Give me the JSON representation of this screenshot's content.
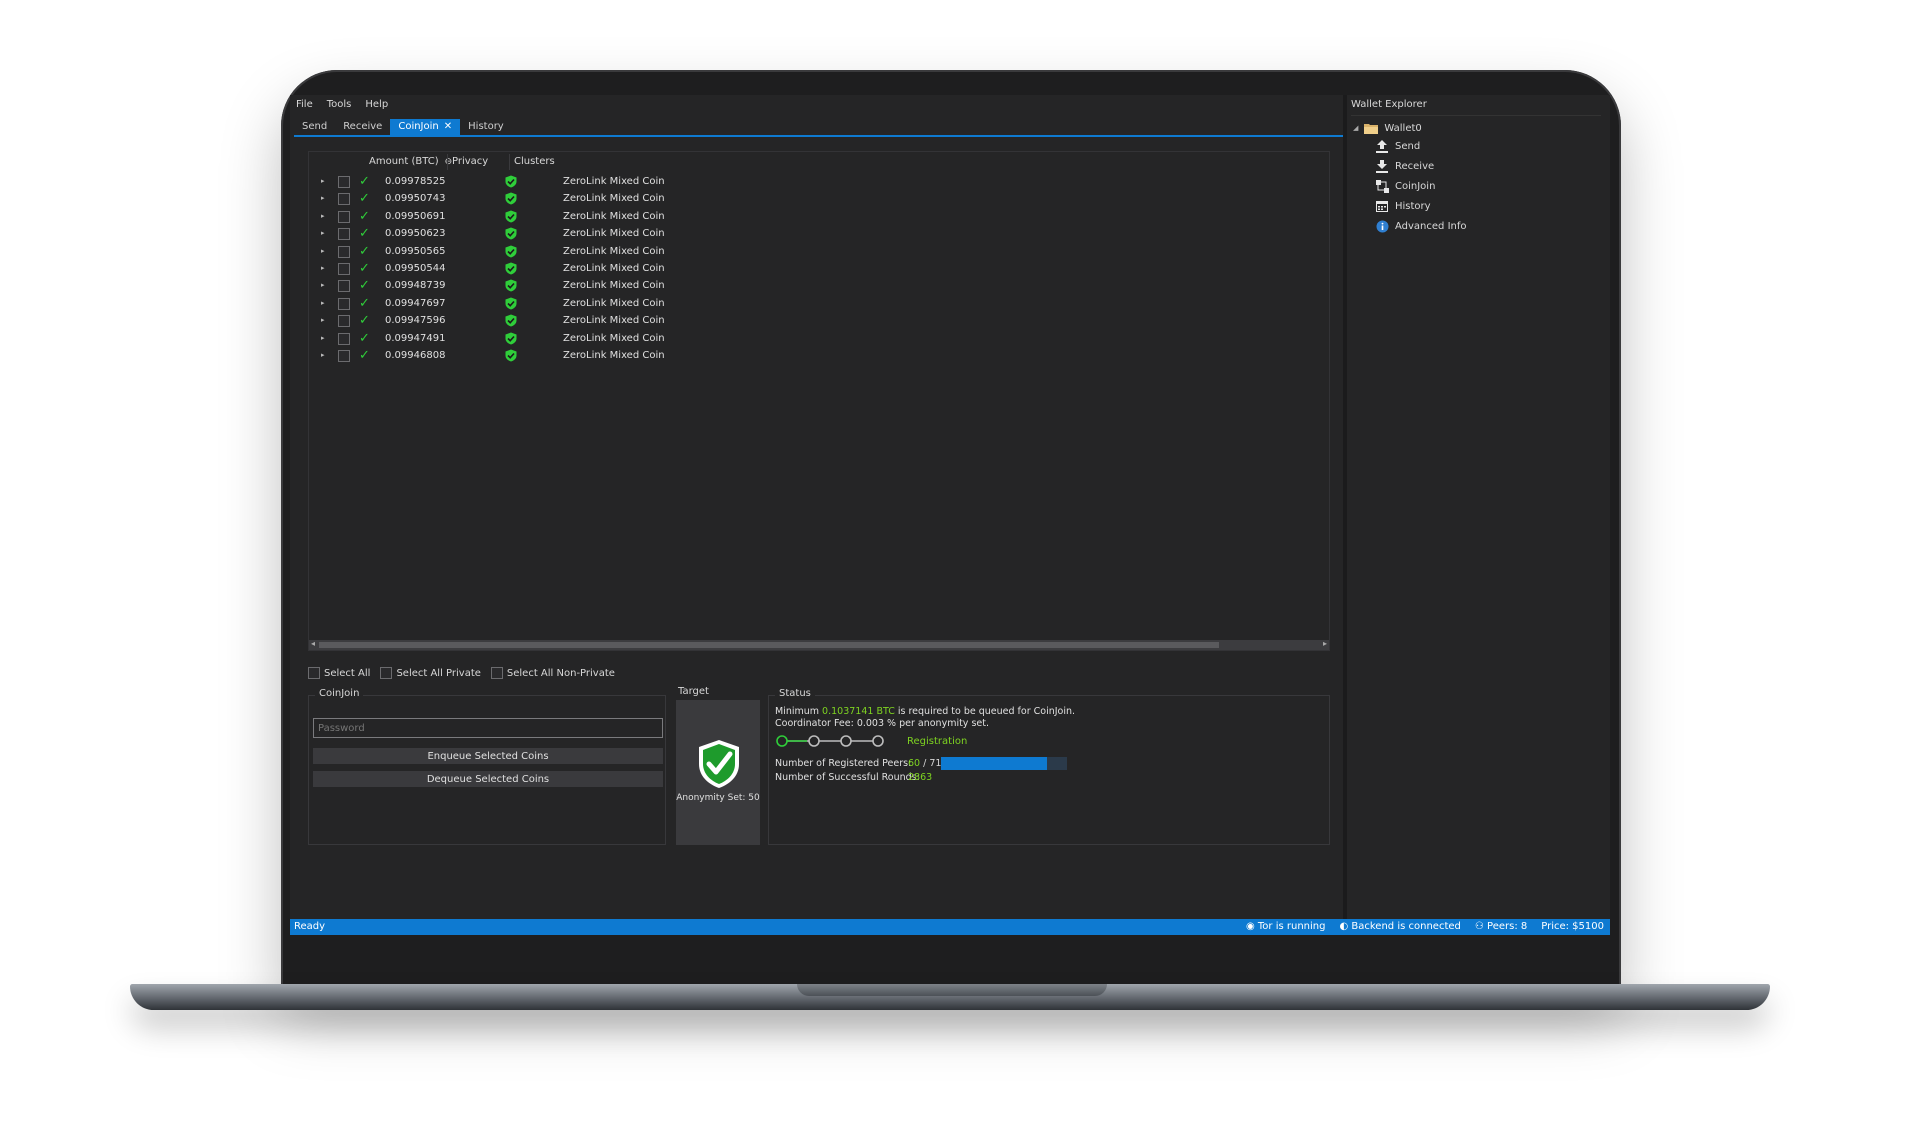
{
  "menu": [
    "File",
    "Tools",
    "Help"
  ],
  "tabs": [
    {
      "label": "Send",
      "active": false
    },
    {
      "label": "Receive",
      "active": false
    },
    {
      "label": "CoinJoin",
      "active": true
    },
    {
      "label": "History",
      "active": false
    }
  ],
  "coinlist": {
    "headers": {
      "amount": "Amount (BTC)",
      "privacy": "Privacy",
      "clusters": "Clusters"
    },
    "rows": [
      {
        "amount": "0.09978525",
        "cluster": "ZeroLink Mixed Coin"
      },
      {
        "amount": "0.09950743",
        "cluster": "ZeroLink Mixed Coin"
      },
      {
        "amount": "0.09950691",
        "cluster": "ZeroLink Mixed Coin"
      },
      {
        "amount": "0.09950623",
        "cluster": "ZeroLink Mixed Coin"
      },
      {
        "amount": "0.09950565",
        "cluster": "ZeroLink Mixed Coin"
      },
      {
        "amount": "0.09950544",
        "cluster": "ZeroLink Mixed Coin"
      },
      {
        "amount": "0.09948739",
        "cluster": "ZeroLink Mixed Coin"
      },
      {
        "amount": "0.09947697",
        "cluster": "ZeroLink Mixed Coin"
      },
      {
        "amount": "0.09947596",
        "cluster": "ZeroLink Mixed Coin"
      },
      {
        "amount": "0.09947491",
        "cluster": "ZeroLink Mixed Coin"
      },
      {
        "amount": "0.09946808",
        "cluster": "ZeroLink Mixed Coin"
      }
    ]
  },
  "select": {
    "all": "Select All",
    "private": "Select All Private",
    "nonprivate": "Select All Non-Private"
  },
  "coinjoin": {
    "title": "CoinJoin",
    "password_placeholder": "Password",
    "enqueue": "Enqueue Selected Coins",
    "dequeue": "Dequeue Selected Coins"
  },
  "target": {
    "title": "Target",
    "anonymity": "Anonymity Set: 50"
  },
  "status": {
    "title": "Status",
    "line1_prefix": "Minimum ",
    "line1_amount": "0.1037141 BTC",
    "line1_suffix": " is required to be queued for CoinJoin.",
    "line2": "Coordinator Fee: 0.003 % per anonymity set.",
    "phase": "Registration",
    "peers_label": "Number of Registered Peers:",
    "peers_registered": "60",
    "peers_sep": " / ",
    "peers_total": "71",
    "peers_fraction": 0.845,
    "rounds_label": "Number of Successful Rounds:",
    "rounds": "2863"
  },
  "explorer": {
    "title": "Wallet Explorer",
    "wallet": "Wallet0",
    "items": [
      "Send",
      "Receive",
      "CoinJoin",
      "History",
      "Advanced Info"
    ]
  },
  "statusbar": {
    "ready": "Ready",
    "tor": "Tor is running",
    "backend": "Backend is connected",
    "peers": "Peers: 8",
    "price": "Price: $5100"
  },
  "colors": {
    "accent": "#0e7ad1",
    "success": "#2fce3a",
    "highlight": "#7ed321",
    "background": "#252526"
  }
}
